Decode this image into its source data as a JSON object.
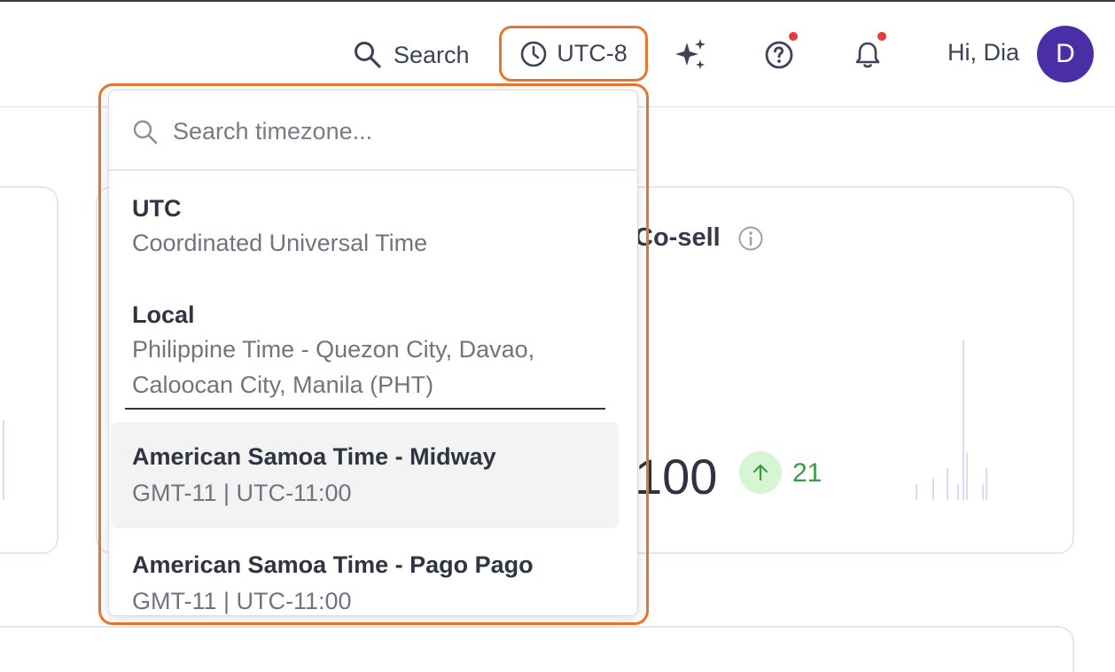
{
  "header": {
    "search_label": "Search",
    "timezone_label": "UTC-8",
    "greeting": "Hi, Dia",
    "avatar_initial": "D"
  },
  "card": {
    "title": "Co-sell",
    "value": "100",
    "delta": "21"
  },
  "timezone_dropdown": {
    "search_placeholder": "Search timezone...",
    "options": [
      {
        "name": "UTC",
        "description": "Coordinated Universal Time"
      },
      {
        "name": "Local",
        "description": "Philippine Time - Quezon City, Davao, Caloocan City, Manila (PHT)"
      },
      {
        "name": "American Samoa Time - Midway",
        "description": "GMT-11 | UTC-11:00"
      },
      {
        "name": "American Samoa Time - Pago Pago",
        "description": "GMT-11 | UTC-11:00"
      }
    ]
  },
  "colors": {
    "accent_highlight": "#e8762c",
    "avatar_bg": "#4a2ea6",
    "notification_dot": "#e63b3b",
    "delta_positive": "#3a9c45"
  }
}
